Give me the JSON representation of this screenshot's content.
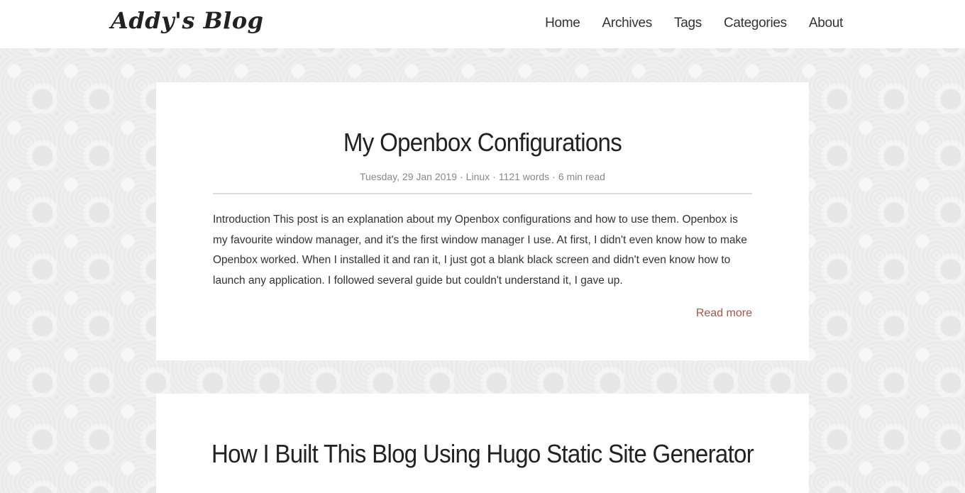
{
  "site": {
    "brand": "Addy's Blog"
  },
  "nav": {
    "items": [
      {
        "label": "Home"
      },
      {
        "label": "Archives"
      },
      {
        "label": "Tags"
      },
      {
        "label": "Categories"
      },
      {
        "label": "About"
      }
    ]
  },
  "posts": [
    {
      "title": "My Openbox Configurations",
      "date": "Tuesday, 29 Jan 2019",
      "category": "Linux",
      "words": "1121 words",
      "read_time": "6 min read",
      "separator": "·",
      "summary": "Introduction This post is an explanation about my Openbox configurations and how to use them. Openbox is my favourite window manager, and it's the first window manager I use. At first, I didn't even know how to make Openbox worked. When I installed it and ran it, I just got a blank black screen and didn't even know how to launch any application. I followed several guide but couldn't understand it, I gave up.",
      "read_more": "Read more"
    },
    {
      "title": "How I Built This Blog Using Hugo Static Site Generator"
    }
  ],
  "colors": {
    "link_accent": "#a9534b",
    "meta_text": "#888888",
    "background": "#efefef"
  }
}
